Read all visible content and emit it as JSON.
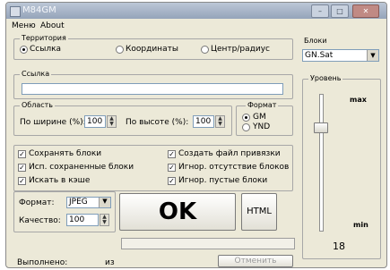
{
  "window": {
    "title": "M84GM",
    "minimize": "–",
    "maximize": "□",
    "close": "✕"
  },
  "menu": [
    "Меню",
    "About"
  ],
  "territory": {
    "label": "Территория",
    "options": [
      "Ссылка",
      "Координаты",
      "Центр/радиус"
    ],
    "selected": 0
  },
  "link": {
    "label": "Ссылка",
    "value": ""
  },
  "area": {
    "label": "Область",
    "width_label": "По ширине (%):",
    "width_value": "100",
    "height_label": "По высоте (%):",
    "height_value": "100"
  },
  "format_group": {
    "label": "Формат",
    "options": [
      "GM",
      "YND"
    ],
    "selected": 0
  },
  "checks": {
    "save_blocks": "Сохранять блоки",
    "use_saved": "Исп. сохраненные блоки",
    "search_cache": "Искать в кэше",
    "create_binding": "Создать файл привязки",
    "ignore_missing": "Игнор. отсутствие блоков",
    "ignore_empty": "Игнор. пустые блоки"
  },
  "image_format": {
    "label": "Формат:",
    "value": "JPEG"
  },
  "quality": {
    "label": "Качество:",
    "value": "100"
  },
  "buttons": {
    "ok": "OK",
    "html": "HTML",
    "cancel": "Отменить"
  },
  "status": {
    "done_label": "Выполнено:",
    "of": "из"
  },
  "blocks": {
    "label": "Блоки",
    "value": "GN.Sat"
  },
  "level": {
    "label": "Уровень",
    "max": "max",
    "min": "min",
    "value": "18"
  },
  "colors": {
    "ok_text": "#000000",
    "disabled_text": "#9a9a9a"
  }
}
